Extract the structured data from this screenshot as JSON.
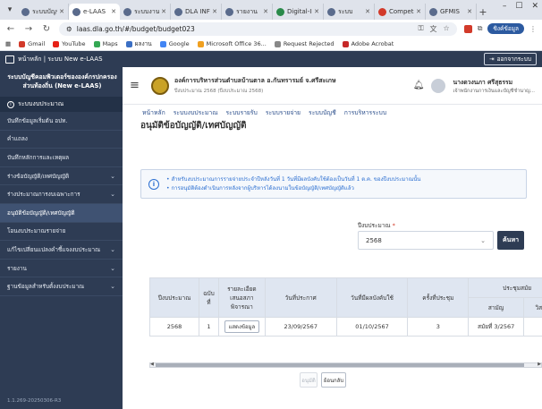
{
  "browser": {
    "tabs": [
      {
        "label": "ระบบบัญชี",
        "active": false
      },
      {
        "label": "e-LAAS",
        "active": true
      },
      {
        "label": "ระบบงาน",
        "active": false
      },
      {
        "label": "DLA INFO",
        "active": false
      },
      {
        "label": "รายงาน",
        "active": false
      },
      {
        "label": "Digital-ID",
        "active": false
      },
      {
        "label": "ระบบ",
        "active": false
      },
      {
        "label": "Competency",
        "active": false
      },
      {
        "label": "GFMIS",
        "active": false
      }
    ],
    "url": "laas.dla.go.th/#/budget/budget023",
    "profile_label": "ซิงค์ข้อมูล",
    "bookmarks": [
      "Gmail",
      "YouTube",
      "Maps",
      "ผลงาน",
      "Google",
      "Microsoft Office 36...",
      "Request Rejected",
      "Adobe Acrobat"
    ]
  },
  "app": {
    "home_label": "หน้าหลัก | ระบบ New e-LAAS",
    "logout_label": "ออกจากระบบ"
  },
  "sidebar": {
    "title": "ระบบบัญชีคอมพิวเตอร์ขององค์กรปกครองส่วนท้องถิ่น (New e-LAAS)",
    "section": "ระบบงบประมาณ",
    "items": [
      {
        "label": "บันทึกข้อมูลเริ่มต้น อปท.",
        "chevron": false,
        "active": false
      },
      {
        "label": "คำแถลง",
        "chevron": false,
        "active": false
      },
      {
        "label": "บันทึกหลักการและเหตุผล",
        "chevron": false,
        "active": false
      },
      {
        "label": "ร่างข้อบัญญัติ/เทศบัญญัติ",
        "chevron": true,
        "active": false
      },
      {
        "label": "ร่างประมาณการงบเฉพาะการ",
        "chevron": true,
        "active": false
      },
      {
        "label": "อนุมัติข้อบัญญัติ/เทศบัญญัติ",
        "chevron": false,
        "active": true
      },
      {
        "label": "โอนงบประมาณรายจ่าย",
        "chevron": false,
        "active": false
      },
      {
        "label": "แก้ไขเปลี่ยนแปลงคำชี้แจงงบประมาณ",
        "chevron": true,
        "active": false
      },
      {
        "label": "รายงาน",
        "chevron": true,
        "active": false
      },
      {
        "label": "ฐานข้อมูลสำหรับตั้งงบประมาณ",
        "chevron": true,
        "active": false
      }
    ],
    "version": "1.1.269-20250306-R3"
  },
  "header": {
    "org_name": "องค์การบริหารส่วนตำบลบ้านตาล อ.กันทรารมย์ จ.ศรีสะเกษ",
    "org_sub": "ปีงบประมาณ 2568 (ปีงบประมาณ 2568)",
    "user_name": "นางดวงนภา ศรีสุธรรม",
    "user_role": "เจ้าพนักงานการเงินและบัญชีชำนาญ..."
  },
  "menu": [
    "หน้าหลัก",
    "ระบบงบประมาณ",
    "ระบบรายรับ",
    "ระบบรายจ่าย",
    "ระบบบัญชี",
    "การบริหารระบบ"
  ],
  "page": {
    "title": "อนุมัติข้อบัญญัติ/เทศบัญญัติ",
    "info_lines": [
      "• สำหรับงบประมาณการรายจ่ายประจำปีหลังวันที่ 1 วันที่มีผลบังคับใช้ต้องเป็นวันที่ 1 ต.ค. ของปีงบประมาณนั้น",
      "• การอนุมัติต้องดำเนินการหลังจากผู้บริหารได้ลงนามในข้อบัญญัติ/เทศบัญญัติแล้ว"
    ],
    "fiscal_year_label": "ปีงบประมาณ",
    "fiscal_year_required": "*",
    "fiscal_year_value": "2568",
    "search_label": "ค้นหา",
    "approve_label": "อนุมัติ",
    "back_label": "ย้อนกลับ"
  },
  "table": {
    "headers": [
      "ปีงบประมาณ",
      "ฉบับที่",
      "รายละเอียดเสนอสภาพิจารณา",
      "วันที่ประกาศ",
      "วันที่มีผลบังคับใช้",
      "ครั้งที่ประชุม",
      "ประชุมสมัย"
    ],
    "subheaders": [
      "สามัญ",
      "วิสามัญ"
    ],
    "rows": [
      {
        "year": "2568",
        "no": "1",
        "detail_btn": "แสดงข้อมูล",
        "announce": "23/09/2567",
        "effective": "01/10/2567",
        "meeting": "3",
        "regular": "สมัยที่ 3/2567",
        "extra": ""
      }
    ]
  }
}
